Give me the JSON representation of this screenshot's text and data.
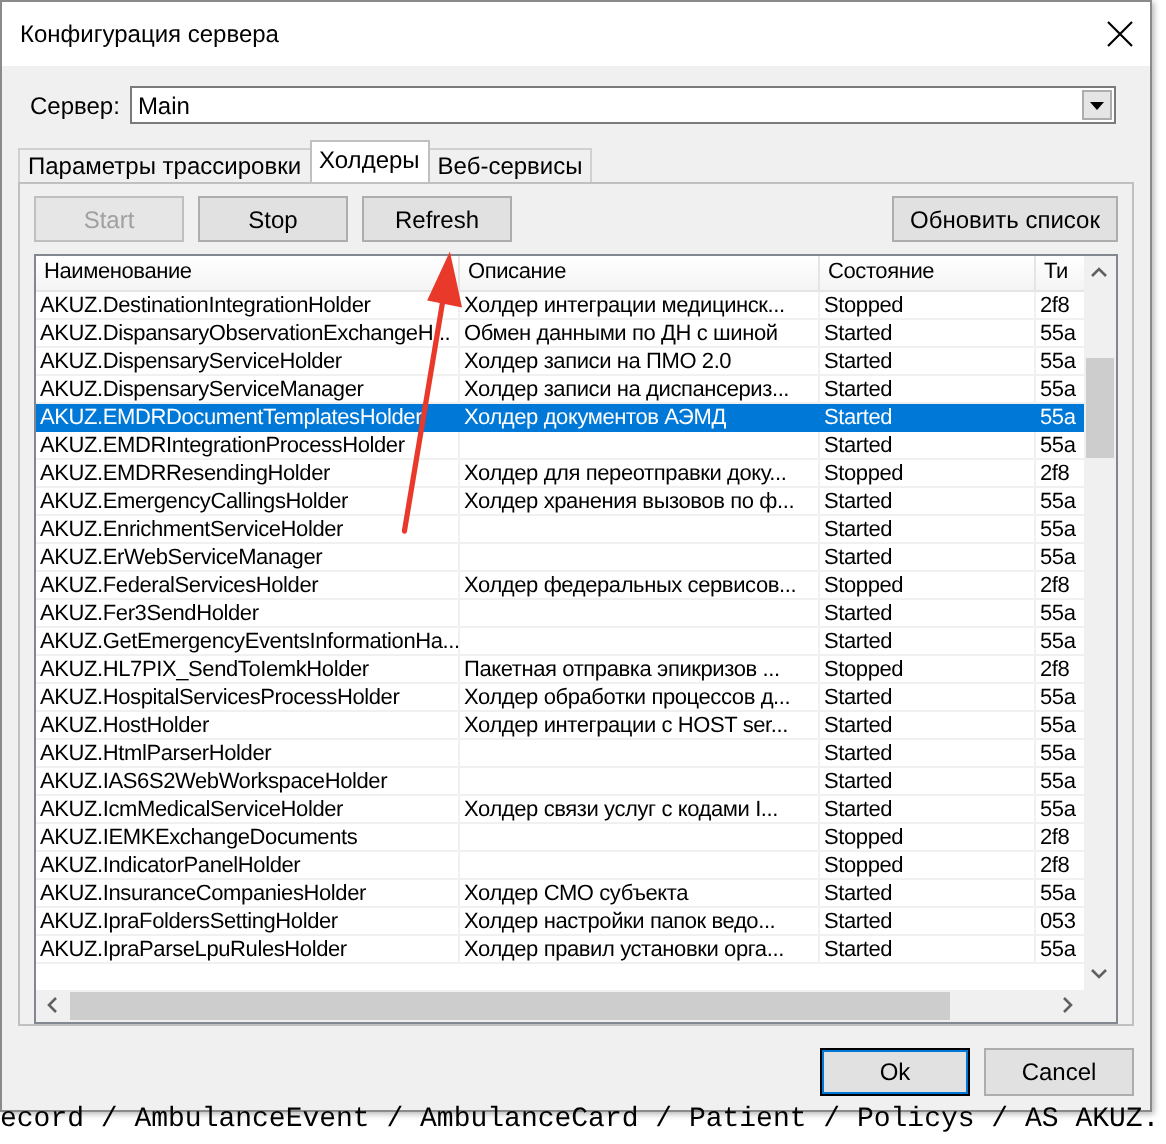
{
  "window": {
    "title": "Конфигурация сервера"
  },
  "server": {
    "label": "Сервер:",
    "value": "Main"
  },
  "tabs": [
    {
      "label": "Параметры трассировки",
      "selected": false
    },
    {
      "label": "Холдеры",
      "selected": true
    },
    {
      "label": "Веб-сервисы",
      "selected": false
    }
  ],
  "toolbar": {
    "buttons": [
      {
        "label": "Start",
        "disabled": true
      },
      {
        "label": "Stop",
        "disabled": false
      },
      {
        "label": "Refresh",
        "disabled": false
      }
    ],
    "refresh_list": "Обновить список"
  },
  "table": {
    "columns": [
      "Наименование",
      "Описание",
      "Состояние",
      "Ти"
    ],
    "rows": [
      {
        "name": "AKUZ.DestinationIntegrationHolder",
        "description": "Холдер интеграции медицинск...",
        "state": "Stopped",
        "type": "2f8",
        "selected": false
      },
      {
        "name": "AKUZ.DispansaryObservationExchangeH...",
        "description": "Обмен данными по ДН с шиной",
        "state": "Started",
        "type": "55a",
        "selected": false
      },
      {
        "name": "AKUZ.DispensaryServiceHolder",
        "description": "Холдер записи на ПМО 2.0",
        "state": "Started",
        "type": "55a",
        "selected": false
      },
      {
        "name": "AKUZ.DispensaryServiceManager",
        "description": "Холдер записи на диспансериз...",
        "state": "Started",
        "type": "55a",
        "selected": false
      },
      {
        "name": "AKUZ.EMDRDocumentTemplatesHolder",
        "description": "Холдер документов АЭМД",
        "state": "Started",
        "type": "55a",
        "selected": true
      },
      {
        "name": "AKUZ.EMDRIntegrationProcessHolder",
        "state": "Started",
        "type": "55a",
        "selected": false
      },
      {
        "name": "AKUZ.EMDRResendingHolder",
        "description": "Холдер для переотправки доку...",
        "state": "Stopped",
        "type": "2f8",
        "selected": false
      },
      {
        "name": "AKUZ.EmergencyCallingsHolder",
        "description": "Холдер хранения вызовов по ф...",
        "state": "Started",
        "type": "55a",
        "selected": false
      },
      {
        "name": "AKUZ.EnrichmentServiceHolder",
        "state": "Started",
        "type": "55a",
        "selected": false
      },
      {
        "name": "AKUZ.ErWebServiceManager",
        "state": "Started",
        "type": "55a",
        "selected": false
      },
      {
        "name": "AKUZ.FederalServicesHolder",
        "description": "Холдер федеральных сервисов...",
        "state": "Stopped",
        "type": "2f8",
        "selected": false
      },
      {
        "name": "AKUZ.Fer3SendHolder",
        "state": "Started",
        "type": "55a",
        "selected": false
      },
      {
        "name": "AKUZ.GetEmergencyEventsInformationHa...",
        "state": "Started",
        "type": "55a",
        "selected": false
      },
      {
        "name": "AKUZ.HL7PIX_SendToIemkHolder",
        "description": "Пакетная отправка эпикризов ...",
        "state": "Stopped",
        "type": "2f8",
        "selected": false
      },
      {
        "name": "AKUZ.HospitalServicesProcessHolder",
        "description": "Холдер обработки процессов д...",
        "state": "Started",
        "type": "55a",
        "selected": false
      },
      {
        "name": "AKUZ.HostHolder",
        "description": "Холдер интеграции с HOST ser...",
        "state": "Started",
        "type": "55a",
        "selected": false
      },
      {
        "name": "AKUZ.HtmlParserHolder",
        "state": "Started",
        "type": "55a",
        "selected": false
      },
      {
        "name": "AKUZ.IAS6S2WebWorkspaceHolder",
        "state": "Started",
        "type": "55a",
        "selected": false
      },
      {
        "name": "AKUZ.IcmMedicalServiceHolder",
        "description": "Холдер связи услуг с кодами I...",
        "state": "Started",
        "type": "55a",
        "selected": false
      },
      {
        "name": "AKUZ.IEMKExchangeDocuments",
        "state": "Stopped",
        "type": "2f8",
        "selected": false
      },
      {
        "name": "AKUZ.IndicatorPanelHolder",
        "state": "Stopped",
        "type": "2f8",
        "selected": false
      },
      {
        "name": "AKUZ.InsuranceCompaniesHolder",
        "description": "Холдер СМО субъекта",
        "state": "Started",
        "type": "55a",
        "selected": false
      },
      {
        "name": "AKUZ.IpraFoldersSettingHolder",
        "description": "Холдер настройки папок ведо...",
        "state": "Started",
        "type": "053",
        "selected": false
      },
      {
        "name": "AKUZ.IpraParseLpuRulesHolder",
        "description": "Холдер правил установки орга...",
        "state": "Started",
        "type": "55a",
        "selected": false
      }
    ]
  },
  "footer": {
    "ok": "Ok",
    "cancel": "Cancel"
  },
  "background_text": "ecord / AmbulanceEvent / AmbulanceCard / Patient / Policys / AS AKUZ."
}
